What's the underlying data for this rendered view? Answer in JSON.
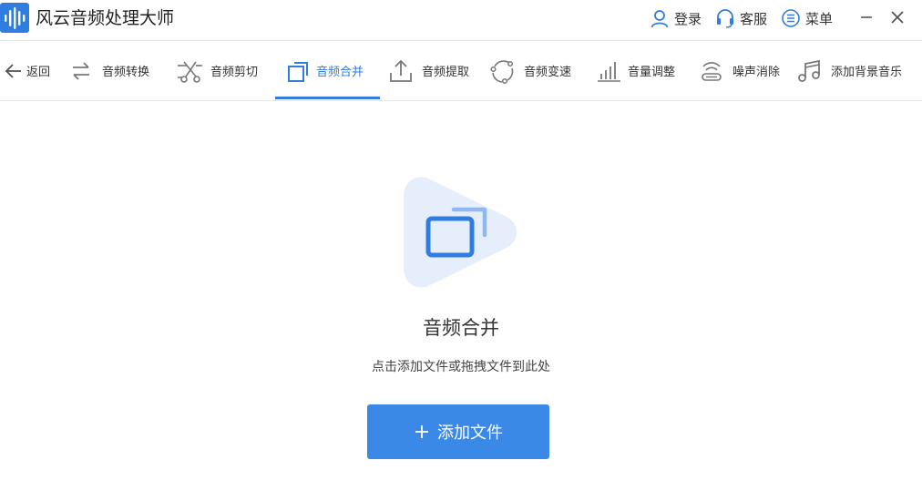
{
  "app": {
    "title": "风云音频处理大师",
    "logo_icon": "waveform-icon",
    "accent_color": "#2f7de1"
  },
  "header_actions": [
    {
      "label": "登录",
      "icon": "user-icon"
    },
    {
      "label": "客服",
      "icon": "headset-icon"
    },
    {
      "label": "菜单",
      "icon": "menu-list-icon"
    }
  ],
  "window_controls": [
    "minimize-icon",
    "close-icon"
  ],
  "toolbar": {
    "back_label": "返回",
    "items": [
      {
        "label": "音频转换",
        "icon": "convert-arrows-icon",
        "active": false
      },
      {
        "label": "音频剪切",
        "icon": "scissors-icon",
        "active": false
      },
      {
        "label": "音频合并",
        "icon": "merge-squares-icon",
        "active": true
      },
      {
        "label": "音频提取",
        "icon": "upload-tray-icon",
        "active": false
      },
      {
        "label": "音频变速",
        "icon": "speed-circle-icon",
        "active": false
      },
      {
        "label": "音量调整",
        "icon": "volume-bars-icon",
        "active": false
      },
      {
        "label": "噪声消除",
        "icon": "noise-wave-icon",
        "active": false
      },
      {
        "label": "添加背景音乐",
        "icon": "music-note-icon",
        "active": false
      }
    ]
  },
  "main": {
    "title": "音频合并",
    "subtitle": "点击添加文件或拖拽文件到此处",
    "add_button_label": "添加文件",
    "hero_icon": "merge-squares-icon"
  }
}
